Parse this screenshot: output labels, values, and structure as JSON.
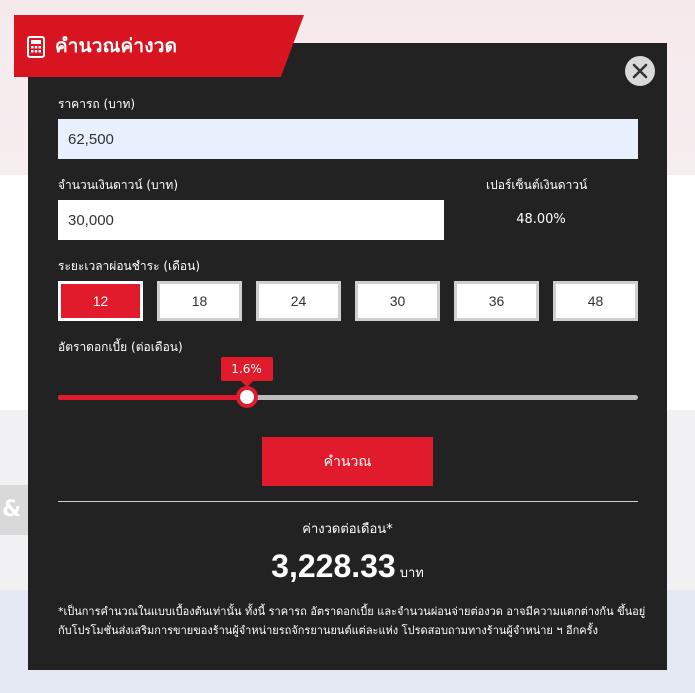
{
  "header": {
    "title": "คำนวณค่างวด",
    "icon": "calculator-icon"
  },
  "close": {
    "icon": "close-icon"
  },
  "price": {
    "label": "ราคารถ (บาท)",
    "value": "62,500"
  },
  "down_payment": {
    "label": "จำนวนเงินดาวน์ (บาท)",
    "value": "30,000"
  },
  "down_percent": {
    "label": "เปอร์เซ็นต์เงินดาวน์",
    "value": "48.00%"
  },
  "term": {
    "label": "ระยะเวลาผ่อนชำระ (เดือน)",
    "options": [
      "12",
      "18",
      "24",
      "30",
      "36",
      "48"
    ],
    "selected": "12"
  },
  "interest": {
    "label": "อัตราดอกเบี้ย (ต่อเดือน)",
    "value_label": "1.6%",
    "slider_fraction": 0.325
  },
  "calculate_button": "คำนวณ",
  "result": {
    "label": "ค่างวดต่อเดือน*",
    "value": "3,228.33",
    "unit": "บาท"
  },
  "footnote": "*เป็นการคำนวณในแบบเบื้องต้นเท่านั้น ทั้งนี้ ราคารถ อัตราดอกเบี้ย และจำนวนผ่อนจ่ายต่องวด อาจมีความแตกต่างกัน ขึ้นอยู่กับโปรโมชั่นส่งเสริมการขายของร้านผู้จำหน่ายรถจักรยานยนต์แต่ละแห่ง โปรดสอบถามทางร้านผู้จำหน่าย ฯ อีกครั้ง",
  "colors": {
    "accent": "#e11b2b",
    "panel": "#222222",
    "input_highlight": "#e8f0fe"
  }
}
